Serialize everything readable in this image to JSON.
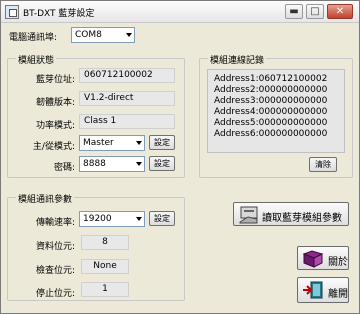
{
  "window": {
    "title": "BT-DXT 藍芽設定",
    "controls": {
      "minimize": "▬",
      "maximize": "□",
      "close": "✕"
    }
  },
  "com_port": {
    "label": "電腦通訊埠:",
    "value": "COM8"
  },
  "module_status": {
    "title": "模組狀態",
    "address": {
      "label": "藍芽位址:",
      "value": "060712100002"
    },
    "firmware": {
      "label": "韌體版本:",
      "value": "V1.2-direct"
    },
    "power": {
      "label": "功率模式:",
      "value": "Class 1"
    },
    "mode": {
      "label": "主/從模式:",
      "value": "Master",
      "button": "設定"
    },
    "pin": {
      "label": "密碼:",
      "value": "8888",
      "button": "設定"
    }
  },
  "connection_log": {
    "title": "模組連線記錄",
    "entries": [
      "Address1:060712100002",
      "Address2:000000000000",
      "Address3:000000000000",
      "Address4:000000000000",
      "Address5:000000000000",
      "Address6:000000000000"
    ],
    "clear_button": "清除"
  },
  "comm_params": {
    "title": "模組通訊參數",
    "baud": {
      "label": "傳輸速率:",
      "value": "19200",
      "button": "設定"
    },
    "data_bits": {
      "label": "資料位元:",
      "value": "8"
    },
    "parity": {
      "label": "檢查位元:",
      "value": "None"
    },
    "stop_bits": {
      "label": "停止位元:",
      "value": "1"
    }
  },
  "actions": {
    "read_params": "讀取藍芽模組參數",
    "about": "關於",
    "exit": "離開"
  },
  "colors": {
    "window_bg": "#ece9d8",
    "about_icon": "#8b2a8b",
    "exit_icon": "#2a7a8b"
  },
  "icons": {
    "read_params": "hand-card-icon",
    "about": "book-icon",
    "exit": "exit-door-icon"
  }
}
